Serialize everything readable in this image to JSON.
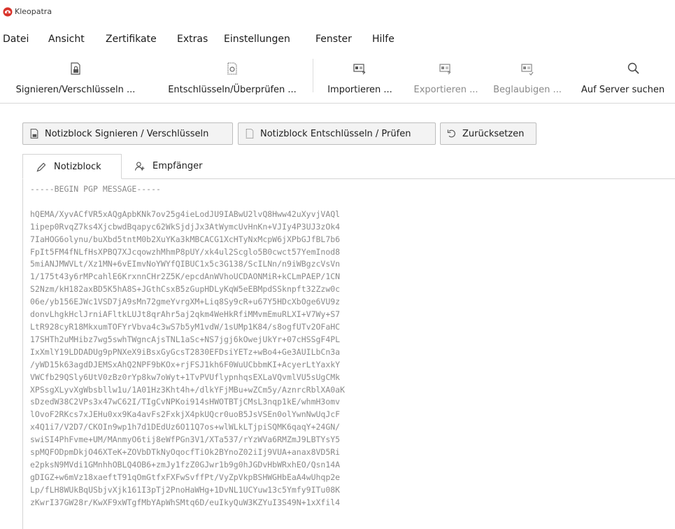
{
  "window": {
    "title": "Kleopatra"
  },
  "menu": [
    "Datei",
    "Ansicht",
    "Zertifikate",
    "Extras",
    "Einstellungen",
    "Fenster",
    "Hilfe"
  ],
  "toolbar": {
    "sign_encrypt": "Signieren/Verschlüsseln ...",
    "decrypt_verify": "Entschlüsseln/Überprüfen ...",
    "import": "Importieren ...",
    "export": "Exportieren ...",
    "certify": "Beglaubigen ...",
    "lookup_server": "Auf Server suchen"
  },
  "actions": {
    "notepad_sign_encrypt": "Notizblock Signieren / Verschlüsseln",
    "notepad_decrypt_verify": "Notizblock Entschlüsseln / Prüfen",
    "reset": "Zurücksetzen"
  },
  "tabs": {
    "notepad": "Notizblock",
    "recipients": "Empfänger"
  },
  "editor": {
    "lines": [
      "-----BEGIN PGP MESSAGE-----",
      "",
      "hQEMA/XyvACfVR5xAQgApbKNk7ov25g4ieLodJU9IABwU2lvQ8Hww42uXyvjVAQl",
      "1ipep0RvqZ7ks4XjcbwdBqapyc62WkSjdjJx3AtWymcUvHnKn+VJIy4P3UJ3zOk4",
      "7IaHOG6olynu/buXbd5tntM0b2XuYKa3kMBCACG1XcHTyNxMcpW6jXPbGJfBL7b6",
      "FpIt5FM4fNLfHsXPBQ7XJcqowzhMhmP8pUY/xk4ul2Scglo5B0cwct57YemInod8",
      "5miANJMWVLt/Xz1MN+6vEImvNoYWYfQIBUC1x5c3G138/ScILNn/n9iWBgzcVsVn",
      "1/175t43y6rMPcahlE6KrxnnCHr2Z5K/epcdAnWVhoUCDAONMiR+kCLmPAEP/1CN",
      "S2Nzm/kH182axBD5K5hA8S+JGthCsxB5zGupHDLyKqW5eEBMpdSSknpft32Zzw0c",
      "06e/yb156EJWc1VSD7jA9sMn72gmeYvrgXM+Liq8Sy9cR+u67Y5HDcXbOge6VU9z",
      "donvLhgkHclJrniAFltkLUJt8qrAhr5aj2qkm4WeHkRfiMMvmEmuRLXI+V7Wy+S7",
      "LtR928cyR18MkxumTOFYrVbva4c3wS7b5yM1vdW/1sUMp1K84/s8ogfUTv2OFaHC",
      "17SHTh2uMHibz7wg5swhTWgncAjsTNL1aSc+NS7jgj6kOwejUkYr+07cHSSgF4PL",
      "IxXmlY19LDDADUg9pPNXeX9iBsxGyGcsT2830EFDsiYETz+wBo4+Ge3AUILbCn3a",
      "/yWD15k63agdDJEMSxAhQ2NPF9bKOx+rjFSJ1kh6F0WuUCbbmKI+AcyerLtYaxkY",
      "VWCfb29QSly6UtV0zBz0rYp8kw7oWyt+1TvPVUflypnhqsEXLaVQvmlVU5sUgCMk",
      "XPSsgXLyvXgWbsbllw1u/1A01Hz3Kht4h+/dlkYFjMBu+wZCm5y/AznrcRblXA0aK",
      "sDzedW38C2VPs3x47wC62I/TIgCvNPKoi914sHWOTBTjCMsL3nqp1kE/whmH3omv",
      "lOvoF2RKcs7xJEHu0xx9Ka4avFs2FxkjX4pkUQcr0uoB5JsVSEn0olYwnNwUqJcF",
      "x4Q1i7/V2D7/CKOIn9wp1h7d1DEdUz6O11Q7os+wlWLkLTjpiSQMK6qaqY+24GN/",
      "swiSI4PhFvme+UM/MAnmyO6tij8eWfPGn3V1/XTa537/rYzWVa6RMZmJ9LBTYsY5",
      "spMQFODpmDkjO46XTeK+ZOVbDTkNyOqocfTiOk2BYnoZ02iIj9VUA+anax8VD5Ri",
      "e2pksN9MVdi1GMnhhOBLQ4OB6+zmJy1fzZ0GJwr1b9g0hJGDvHbWRxhEO/Qsn14A",
      "gDIGZ+w6mVz18xaeftT91qOmGtfxFXFwSvffPt/VyZpVkpBSHWGHbEaA4wUhqp2e",
      "Lp/fLH8WUkBqUSbjvXjk161I3pTj2PnoHaWHg+1DvNL1UCYuw13c5Ymfy9ITu08K",
      "zKwrI37GW28r/KwXF9xWTgfMbYApWhSMtq6D/euIkyQuW3KZYuI3S49N+1xXfil4"
    ]
  }
}
